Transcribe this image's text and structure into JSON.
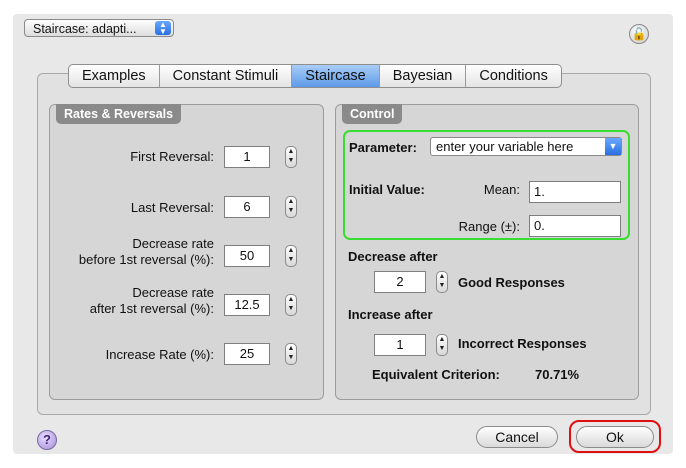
{
  "header": {
    "method_popup": "Staircase: adapti...",
    "lock_icon": "lock-icon"
  },
  "tabs": [
    {
      "label": "Examples",
      "active": false
    },
    {
      "label": "Constant Stimuli",
      "active": false
    },
    {
      "label": "Staircase",
      "active": true
    },
    {
      "label": "Bayesian",
      "active": false
    },
    {
      "label": "Conditions",
      "active": false
    }
  ],
  "rates": {
    "title": "Rates & Reversals",
    "first_reversal_label": "First Reversal:",
    "first_reversal_value": "1",
    "last_reversal_label": "Last Reversal:",
    "last_reversal_value": "6",
    "decrease_before_label_1": "Decrease rate",
    "decrease_before_label_2": "before 1st reversal (%):",
    "decrease_before_value": "50",
    "decrease_after_label_1": "Decrease rate",
    "decrease_after_label_2": "after 1st reversal (%):",
    "decrease_after_value": "12.5",
    "increase_label": "Increase Rate (%):",
    "increase_value": "25"
  },
  "control": {
    "title": "Control",
    "parameter_label": "Parameter:",
    "parameter_value": "enter your variable here",
    "initial_value_label": "Initial Value:",
    "mean_label": "Mean:",
    "mean_value": "1.",
    "range_label": "Range (±):",
    "range_value": "0.",
    "decrease_after_label": "Decrease after",
    "decrease_after_value": "2",
    "good_responses_label": "Good Responses",
    "increase_after_label": "Increase after",
    "increase_after_value": "1",
    "incorrect_responses_label": "Incorrect Responses",
    "equivalent_label": "Equivalent Criterion:",
    "equivalent_value": "70.71%"
  },
  "footer": {
    "help": "?",
    "cancel": "Cancel",
    "ok": "Ok"
  },
  "colors": {
    "highlight_green": "#39dd32",
    "highlight_red": "#e01010",
    "tab_active": "#5d9ae8"
  }
}
